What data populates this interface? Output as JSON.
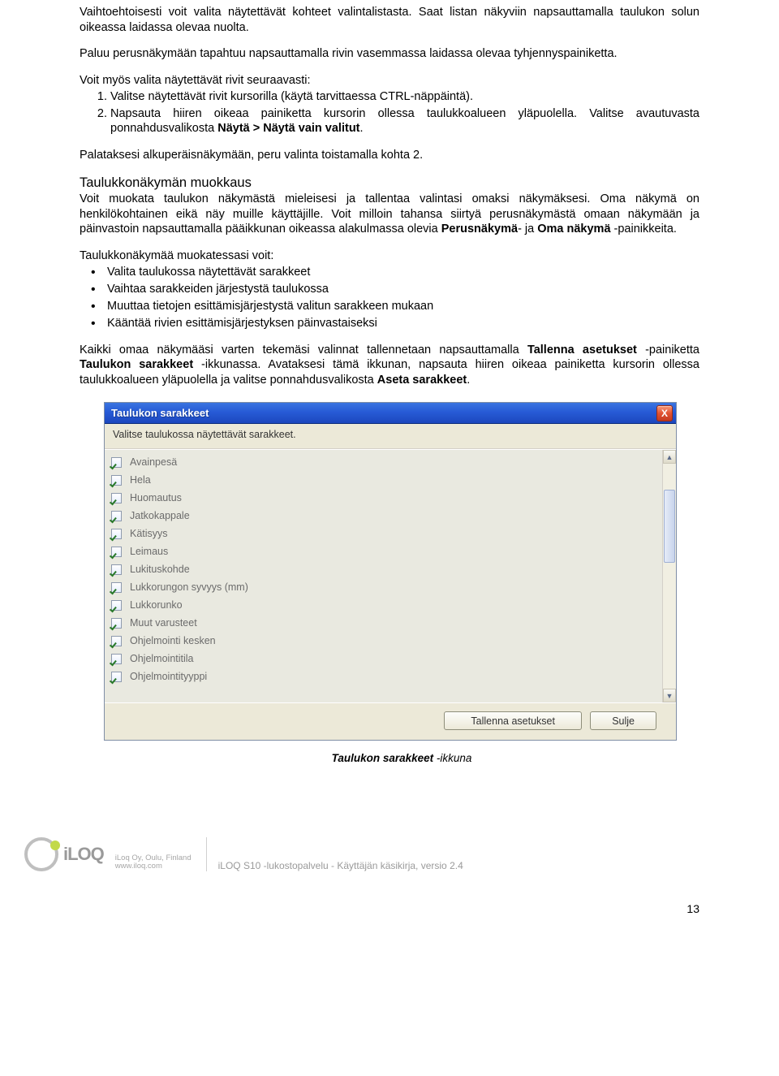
{
  "para1": "Vaihtoehtoisesti voit valita näytettävät kohteet valintalistasta. Saat listan näkyviin napsauttamalla taulukon solun oikeassa laidassa olevaa nuolta.",
  "para2": "Paluu perusnäkymään tapahtuu napsauttamalla rivin vasemmassa laidassa olevaa tyhjennys­painiketta.",
  "para3": "Voit myös valita näytettävät rivit seuraavasti:",
  "list1_1": "Valitse näytettävät rivit kursorilla (käytä tarvittaessa CTRL-näppäintä).",
  "list1_2a": "Napsauta hiiren oikeaa painiketta kursorin ollessa taulukkoalueen yläpuolella. Valitse avautuvasta ponnahdusvalikosta ",
  "list1_2b": "Näytä > Näytä vain valitut",
  "list1_2c": ".",
  "para4": "Palataksesi alkuperäisnäkymään, peru valinta toistamalla kohta 2.",
  "h3": "Taulukkonäkymän muokkaus",
  "para5a": "Voit muokata taulukon näkymästä mieleisesi ja tallentaa valintasi omaksi näkymäksesi. Oma näkymä on henkilökohtainen eikä näy muille käyttäjille. Voit milloin tahansa siirtyä perusnäkymästä omaan näkymään ja päinvastoin napsauttamalla pääikkunan oikeassa alakulmassa olevia ",
  "para5b": "Perus­näkymä",
  "para5c": "- ja ",
  "para5d": "Oma näkymä",
  "para5e": " -painikkeita.",
  "para6": "Taulukkonäkymää muokatessasi voit:",
  "ul1": "Valita taulukossa näytettävät sarakkeet",
  "ul2": "Vaihtaa sarakkeiden järjestystä taulukossa",
  "ul3": "Muuttaa tietojen esittämisjärjestystä valitun sarakkeen mukaan",
  "ul4": "Kääntää rivien esittämisjärjestyksen päinvastaiseksi",
  "para7a": "Kaikki omaa näkymääsi varten tekemäsi valinnat tallennetaan napsauttamalla ",
  "para7b": "Tallenna asetukset",
  "para7c": " -painiketta ",
  "para7d": "Taulukon sarakkeet",
  "para7e": " -ikkunassa. Avataksesi tämä ikkunan, napsauta hiiren oikeaa painiketta kursorin ollessa taulukkoalueen yläpuolella ja valitse ponnahdusvalikosta ",
  "para7f": "Aseta sarakkeet",
  "para7g": ".",
  "dialog": {
    "title": "Taulukon sarakkeet",
    "instr": "Valitse taulukossa näytettävät sarakkeet.",
    "items": [
      "Avainpesä",
      "Hela",
      "Huomautus",
      "Jatkokappale",
      "Kätisyys",
      "Leimaus",
      "Lukituskohde",
      "Lukkorungon syvyys (mm)",
      "Lukkorunko",
      "Muut varusteet",
      "Ohjelmointi kesken",
      "Ohjelmointitila",
      "Ohjelmointityyppi"
    ],
    "save": "Tallenna asetukset",
    "close": "Sulje",
    "close_x": "X"
  },
  "caption_bold": "Taulukon sarakkeet",
  "caption_rest": " -ikkuna",
  "footer": {
    "logo_text": "iLOQ",
    "company1": "iLoq Oy, Oulu, Finland",
    "company2": "www.iloq.com",
    "doc": "iLOQ S10 -lukostopalvelu - Käyttäjän käsikirja, versio 2.4",
    "page": "13"
  }
}
